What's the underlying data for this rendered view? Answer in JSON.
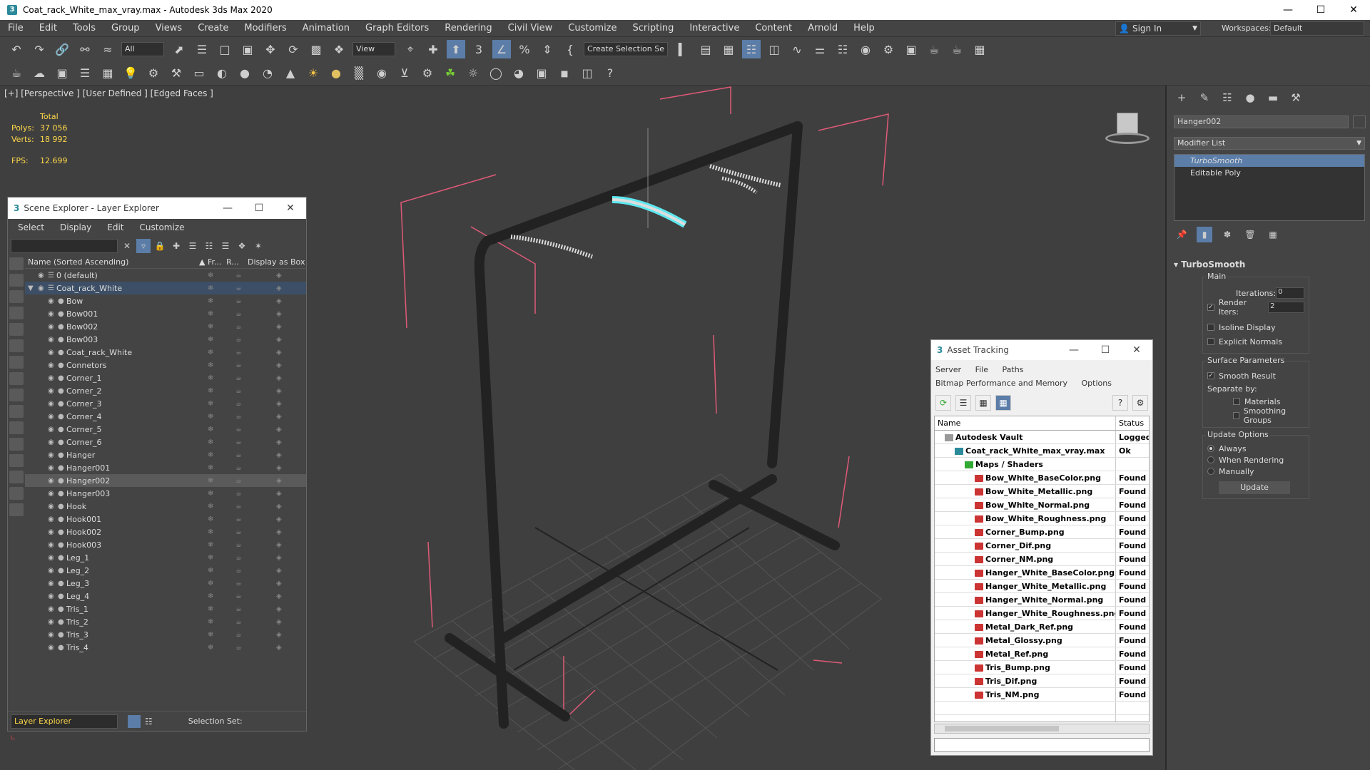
{
  "window": {
    "title": "Coat_rack_White_max_vray.max - Autodesk 3ds Max 2020"
  },
  "menubar": {
    "items": [
      "File",
      "Edit",
      "Tools",
      "Group",
      "Views",
      "Create",
      "Modifiers",
      "Animation",
      "Graph Editors",
      "Rendering",
      "Civil View",
      "Customize",
      "Scripting",
      "Interactive",
      "Content",
      "Arnold",
      "Help"
    ],
    "sign_in": "Sign In",
    "workspaces_label": "Workspaces:",
    "workspaces_value": "Default"
  },
  "toolbar": {
    "filter_value": "All",
    "view_value": "View",
    "selection_set": "Create Selection Se"
  },
  "viewport": {
    "label": "[+] [Perspective ] [User Defined ] [Edged Faces ]",
    "stats_header": "Total",
    "polys_label": "Polys:",
    "polys_value": "37 056",
    "verts_label": "Verts:",
    "verts_value": "18 992",
    "fps_label": "FPS:",
    "fps_value": "12.699"
  },
  "scene_explorer": {
    "title": "Scene Explorer - Layer Explorer",
    "menu": [
      "Select",
      "Display",
      "Edit",
      "Customize"
    ],
    "columns": {
      "name": "Name (Sorted Ascending)",
      "frozen": "▲ Fr...",
      "render": "R...",
      "display_box": "Display as Box"
    },
    "rows": [
      {
        "name": "0 (default)",
        "indent": 1,
        "state": ""
      },
      {
        "name": "Coat_rack_White",
        "indent": 1,
        "state": "parent"
      },
      {
        "name": "Bow",
        "indent": 2,
        "state": ""
      },
      {
        "name": "Bow001",
        "indent": 2,
        "state": ""
      },
      {
        "name": "Bow002",
        "indent": 2,
        "state": ""
      },
      {
        "name": "Bow003",
        "indent": 2,
        "state": ""
      },
      {
        "name": "Coat_rack_White",
        "indent": 2,
        "state": ""
      },
      {
        "name": "Connetors",
        "indent": 2,
        "state": ""
      },
      {
        "name": "Corner_1",
        "indent": 2,
        "state": ""
      },
      {
        "name": "Corner_2",
        "indent": 2,
        "state": ""
      },
      {
        "name": "Corner_3",
        "indent": 2,
        "state": ""
      },
      {
        "name": "Corner_4",
        "indent": 2,
        "state": ""
      },
      {
        "name": "Corner_5",
        "indent": 2,
        "state": ""
      },
      {
        "name": "Corner_6",
        "indent": 2,
        "state": ""
      },
      {
        "name": "Hanger",
        "indent": 2,
        "state": ""
      },
      {
        "name": "Hanger001",
        "indent": 2,
        "state": ""
      },
      {
        "name": "Hanger002",
        "indent": 2,
        "state": "sel"
      },
      {
        "name": "Hanger003",
        "indent": 2,
        "state": ""
      },
      {
        "name": "Hook",
        "indent": 2,
        "state": ""
      },
      {
        "name": "Hook001",
        "indent": 2,
        "state": ""
      },
      {
        "name": "Hook002",
        "indent": 2,
        "state": ""
      },
      {
        "name": "Hook003",
        "indent": 2,
        "state": ""
      },
      {
        "name": "Leg_1",
        "indent": 2,
        "state": ""
      },
      {
        "name": "Leg_2",
        "indent": 2,
        "state": ""
      },
      {
        "name": "Leg_3",
        "indent": 2,
        "state": ""
      },
      {
        "name": "Leg_4",
        "indent": 2,
        "state": ""
      },
      {
        "name": "Tris_1",
        "indent": 2,
        "state": ""
      },
      {
        "name": "Tris_2",
        "indent": 2,
        "state": ""
      },
      {
        "name": "Tris_3",
        "indent": 2,
        "state": ""
      },
      {
        "name": "Tris_4",
        "indent": 2,
        "state": ""
      }
    ],
    "explorer_select": "Layer Explorer",
    "selection_set_label": "Selection Set:"
  },
  "command_panel": {
    "object_name": "Hanger002",
    "modifier_list": "Modifier List",
    "stack": [
      "TurboSmooth",
      "Editable Poly"
    ],
    "rollout_title": "TurboSmooth",
    "main_label": "Main",
    "iterations_label": "Iterations:",
    "iterations_value": "0",
    "render_iters_label": "Render Iters:",
    "render_iters_value": "2",
    "isoline_label": "Isoline Display",
    "explicit_normals_label": "Explicit Normals",
    "surface_params_label": "Surface Parameters",
    "smooth_result_label": "Smooth Result",
    "separate_by_label": "Separate by:",
    "materials_label": "Materials",
    "smoothing_groups_label": "Smoothing Groups",
    "update_options_label": "Update Options",
    "always_label": "Always",
    "when_rendering_label": "When Rendering",
    "manually_label": "Manually",
    "update_button": "Update"
  },
  "asset_tracking": {
    "title": "Asset Tracking",
    "menu_row1": [
      "Server",
      "File",
      "Paths"
    ],
    "menu_row2": [
      "Bitmap Performance and Memory",
      "Options"
    ],
    "col_name": "Name",
    "col_status": "Status",
    "rows": [
      {
        "name": "Autodesk Vault",
        "status": "Logged",
        "icon": "vault",
        "indent": 1
      },
      {
        "name": "Coat_rack_White_max_vray.max",
        "status": "Ok",
        "icon": "file",
        "indent": 2
      },
      {
        "name": "Maps / Shaders",
        "status": "",
        "icon": "folder",
        "indent": 3
      },
      {
        "name": "Bow_White_BaseColor.png",
        "status": "Found",
        "icon": "png",
        "indent": 4
      },
      {
        "name": "Bow_White_Metallic.png",
        "status": "Found",
        "icon": "png",
        "indent": 4
      },
      {
        "name": "Bow_White_Normal.png",
        "status": "Found",
        "icon": "png",
        "indent": 4
      },
      {
        "name": "Bow_White_Roughness.png",
        "status": "Found",
        "icon": "png",
        "indent": 4
      },
      {
        "name": "Corner_Bump.png",
        "status": "Found",
        "icon": "png",
        "indent": 4
      },
      {
        "name": "Corner_Dif.png",
        "status": "Found",
        "icon": "png",
        "indent": 4
      },
      {
        "name": "Corner_NM.png",
        "status": "Found",
        "icon": "png",
        "indent": 4
      },
      {
        "name": "Hanger_White_BaseColor.png",
        "status": "Found",
        "icon": "png",
        "indent": 4
      },
      {
        "name": "Hanger_White_Metallic.png",
        "status": "Found",
        "icon": "png",
        "indent": 4
      },
      {
        "name": "Hanger_White_Normal.png",
        "status": "Found",
        "icon": "png",
        "indent": 4
      },
      {
        "name": "Hanger_White_Roughness.png",
        "status": "Found",
        "icon": "png",
        "indent": 4
      },
      {
        "name": "Metal_Dark_Ref.png",
        "status": "Found",
        "icon": "png",
        "indent": 4
      },
      {
        "name": "Metal_Glossy.png",
        "status": "Found",
        "icon": "png",
        "indent": 4
      },
      {
        "name": "Metal_Ref.png",
        "status": "Found",
        "icon": "png",
        "indent": 4
      },
      {
        "name": "Tris_Bump.png",
        "status": "Found",
        "icon": "png",
        "indent": 4
      },
      {
        "name": "Tris_Dif.png",
        "status": "Found",
        "icon": "png",
        "indent": 4
      },
      {
        "name": "Tris_NM.png",
        "status": "Found",
        "icon": "png",
        "indent": 4
      }
    ]
  },
  "colors": {
    "accent_selected": "#5b7da8",
    "stats_yellow": "#ffd94a",
    "bbox_pink": "#e05a78",
    "hanger_highlight": "#5ee8f0"
  }
}
